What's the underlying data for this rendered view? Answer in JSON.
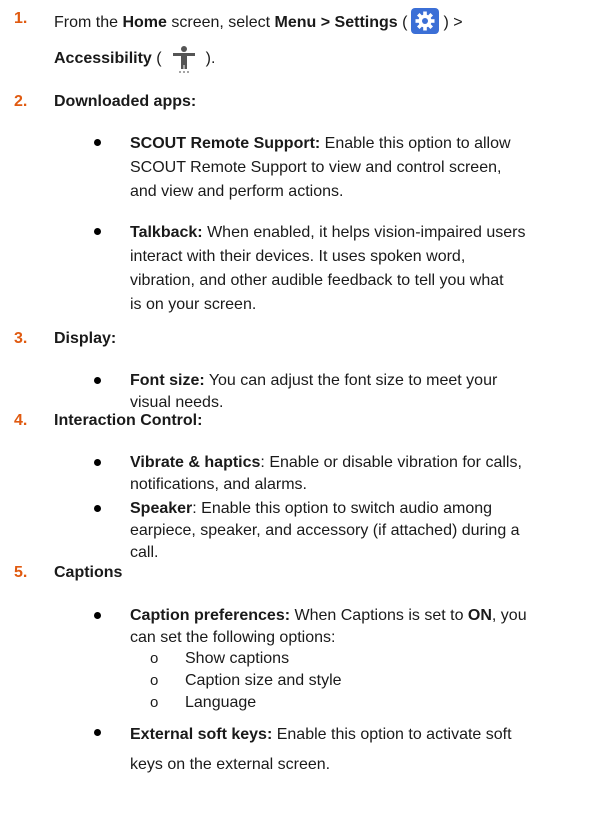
{
  "steps": [
    {
      "number": "1.",
      "line1_pre": "From the ",
      "line1_b1": "Home",
      "line1_mid": " screen, select ",
      "line1_b2": "Menu > Settings",
      "line1_open": " (",
      "line1_close": ") >",
      "line2_b": "Accessibility",
      "line2_open": " (",
      "line2_close": ")."
    },
    {
      "number": "2.",
      "title": "Downloaded apps:"
    },
    {
      "number": "3.",
      "title": "Display:"
    },
    {
      "number": "4.",
      "title": "Interaction Control:"
    },
    {
      "number": "5.",
      "title": "Captions"
    }
  ],
  "bullets": {
    "scout": {
      "label": "SCOUT Remote Support:",
      "l1": " Enable this option to allow",
      "l2": "SCOUT Remote Support to view and control screen,",
      "l3": "and view and perform actions."
    },
    "talkback": {
      "label": "Talkback:",
      "l1": " When enabled, it helps vision-impaired users",
      "l2": "interact with their devices. It uses spoken word,",
      "l3": "vibration, and other audible feedback to tell you what",
      "l4": "is on your screen."
    },
    "fontsize": {
      "label": "Font size:",
      "l1": " You can adjust the font size to meet your",
      "l2": "visual needs."
    },
    "vibrate": {
      "label": "Vibrate & haptics",
      "l1": ": Enable or disable vibration for calls,",
      "l2": "notifications, and alarms."
    },
    "speaker": {
      "label": "Speaker",
      "l1": ": Enable this option to switch audio among",
      "l2": "earpiece, speaker, and accessory (if attached) during a",
      "l3": "call."
    },
    "captionprefs": {
      "label": "Caption preferences:",
      "l1a": " When Captions is set to ",
      "l1b": "ON",
      "l1c": ", you",
      "l2": "can set the following options:"
    },
    "softkeys": {
      "label": "External soft keys:",
      "l1": " Enable this option to activate soft",
      "l2": "keys on the external screen."
    }
  },
  "subitems": {
    "marker": "o",
    "items": [
      "Show captions",
      "Caption size and style",
      "Language"
    ]
  },
  "icons": {
    "settings": "gear-icon",
    "accessibility": "accessibility-person-icon",
    "settings_bg": "#3b6fd6",
    "step_number_color": "#e05a10"
  }
}
